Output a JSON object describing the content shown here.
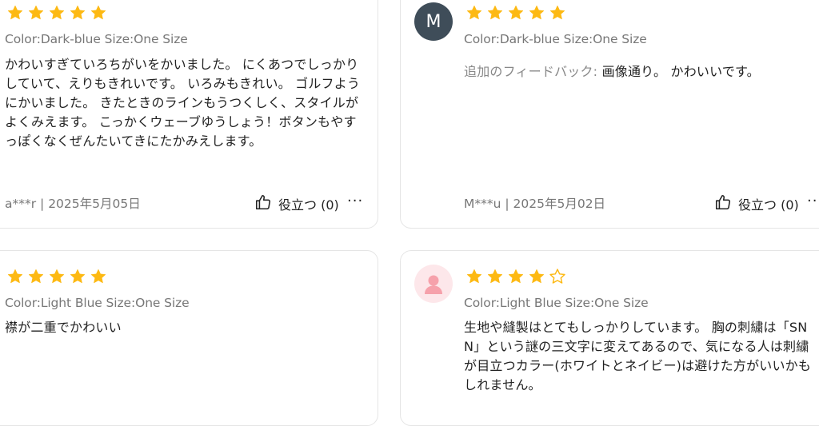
{
  "colors": {
    "star_fill": "#FDB913",
    "avatar_dark": "#3F4D59",
    "avatar_pink": "#FDE7EA",
    "avatar_figure": "#F6A1AB"
  },
  "reviews": [
    {
      "rating": 5,
      "variant": "Color:Dark-blue Size:One Size",
      "text": "かわいすぎていろちがいをかいました。 にくあつでしっかりしていて、えりもきれいです。 いろみもきれい。 ゴルフようにかいました。 きたときのラインもうつくしく、スタイルがよくみえます。 こっかくウェーブゆうしょう！ボタンもやすっぽくなくぜんたいてきにたかみえします。",
      "footer": "a***r | 2025年5月05日",
      "helpful_label": "役立つ (0)",
      "more": "···"
    },
    {
      "avatar_letter": "M",
      "rating": 5,
      "variant": "Color:Dark-blue Size:One Size",
      "feedback_label": "追加のフィードバック:",
      "text": " 画像通り。 かわいいです。",
      "footer": "M***u | 2025年5月02日",
      "helpful_label": "役立つ (0)",
      "more": "···"
    },
    {
      "rating": 5,
      "variant": "Color:Light Blue Size:One Size",
      "text": "襟が二重でかわいい"
    },
    {
      "avatar_icon": "user-avatar-icon",
      "rating": 4,
      "variant": "Color:Light Blue Size:One Size",
      "text": "生地や縫製はとてもしっかりしています。 胸の刺繍は「SNN」という謎の三文字に変えてあるので、気になる人は刺繍が目立つカラー(ホワイトとネイビー)は避けた方がいいかもしれません。"
    }
  ]
}
